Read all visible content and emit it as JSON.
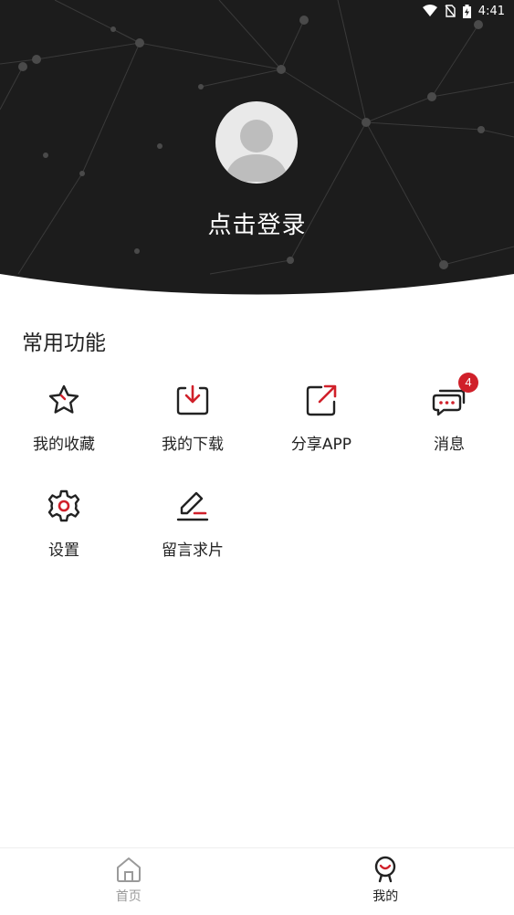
{
  "status_bar": {
    "time": "4:41"
  },
  "profile": {
    "login_text": "点击登录"
  },
  "section": {
    "title": "常用功能"
  },
  "functions": [
    {
      "label": "我的收藏",
      "icon": "star-icon"
    },
    {
      "label": "我的下载",
      "icon": "download-icon"
    },
    {
      "label": "分享APP",
      "icon": "share-icon"
    },
    {
      "label": "消息",
      "icon": "message-icon",
      "badge": "4"
    },
    {
      "label": "设置",
      "icon": "gear-icon"
    },
    {
      "label": "留言求片",
      "icon": "edit-icon"
    }
  ],
  "tabbar": {
    "tabs": [
      {
        "label": "首页",
        "icon": "home-icon",
        "active": false
      },
      {
        "label": "我的",
        "icon": "profile-icon",
        "active": true
      }
    ]
  },
  "colors": {
    "accent": "#d0202a",
    "header_bg": "#1c1c1c"
  }
}
